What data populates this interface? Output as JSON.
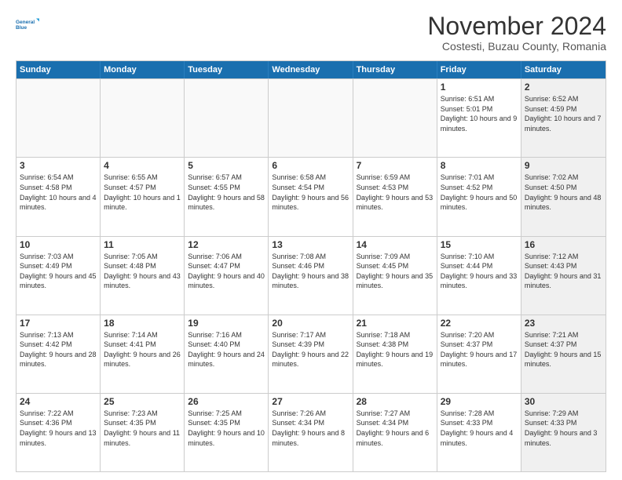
{
  "logo": {
    "line1": "General",
    "line2": "Blue"
  },
  "title": "November 2024",
  "subtitle": "Costesti, Buzau County, Romania",
  "header": {
    "days": [
      "Sunday",
      "Monday",
      "Tuesday",
      "Wednesday",
      "Thursday",
      "Friday",
      "Saturday"
    ]
  },
  "weeks": [
    {
      "cells": [
        {
          "day": "",
          "info": "",
          "empty": true
        },
        {
          "day": "",
          "info": "",
          "empty": true
        },
        {
          "day": "",
          "info": "",
          "empty": true
        },
        {
          "day": "",
          "info": "",
          "empty": true
        },
        {
          "day": "",
          "info": "",
          "empty": true
        },
        {
          "day": "1",
          "info": "Sunrise: 6:51 AM\nSunset: 5:01 PM\nDaylight: 10 hours and 9 minutes.",
          "empty": false
        },
        {
          "day": "2",
          "info": "Sunrise: 6:52 AM\nSunset: 4:59 PM\nDaylight: 10 hours and 7 minutes.",
          "empty": false,
          "shaded": true
        }
      ]
    },
    {
      "cells": [
        {
          "day": "3",
          "info": "Sunrise: 6:54 AM\nSunset: 4:58 PM\nDaylight: 10 hours and 4 minutes.",
          "empty": false
        },
        {
          "day": "4",
          "info": "Sunrise: 6:55 AM\nSunset: 4:57 PM\nDaylight: 10 hours and 1 minute.",
          "empty": false
        },
        {
          "day": "5",
          "info": "Sunrise: 6:57 AM\nSunset: 4:55 PM\nDaylight: 9 hours and 58 minutes.",
          "empty": false
        },
        {
          "day": "6",
          "info": "Sunrise: 6:58 AM\nSunset: 4:54 PM\nDaylight: 9 hours and 56 minutes.",
          "empty": false
        },
        {
          "day": "7",
          "info": "Sunrise: 6:59 AM\nSunset: 4:53 PM\nDaylight: 9 hours and 53 minutes.",
          "empty": false
        },
        {
          "day": "8",
          "info": "Sunrise: 7:01 AM\nSunset: 4:52 PM\nDaylight: 9 hours and 50 minutes.",
          "empty": false
        },
        {
          "day": "9",
          "info": "Sunrise: 7:02 AM\nSunset: 4:50 PM\nDaylight: 9 hours and 48 minutes.",
          "empty": false,
          "shaded": true
        }
      ]
    },
    {
      "cells": [
        {
          "day": "10",
          "info": "Sunrise: 7:03 AM\nSunset: 4:49 PM\nDaylight: 9 hours and 45 minutes.",
          "empty": false
        },
        {
          "day": "11",
          "info": "Sunrise: 7:05 AM\nSunset: 4:48 PM\nDaylight: 9 hours and 43 minutes.",
          "empty": false
        },
        {
          "day": "12",
          "info": "Sunrise: 7:06 AM\nSunset: 4:47 PM\nDaylight: 9 hours and 40 minutes.",
          "empty": false
        },
        {
          "day": "13",
          "info": "Sunrise: 7:08 AM\nSunset: 4:46 PM\nDaylight: 9 hours and 38 minutes.",
          "empty": false
        },
        {
          "day": "14",
          "info": "Sunrise: 7:09 AM\nSunset: 4:45 PM\nDaylight: 9 hours and 35 minutes.",
          "empty": false
        },
        {
          "day": "15",
          "info": "Sunrise: 7:10 AM\nSunset: 4:44 PM\nDaylight: 9 hours and 33 minutes.",
          "empty": false
        },
        {
          "day": "16",
          "info": "Sunrise: 7:12 AM\nSunset: 4:43 PM\nDaylight: 9 hours and 31 minutes.",
          "empty": false,
          "shaded": true
        }
      ]
    },
    {
      "cells": [
        {
          "day": "17",
          "info": "Sunrise: 7:13 AM\nSunset: 4:42 PM\nDaylight: 9 hours and 28 minutes.",
          "empty": false
        },
        {
          "day": "18",
          "info": "Sunrise: 7:14 AM\nSunset: 4:41 PM\nDaylight: 9 hours and 26 minutes.",
          "empty": false
        },
        {
          "day": "19",
          "info": "Sunrise: 7:16 AM\nSunset: 4:40 PM\nDaylight: 9 hours and 24 minutes.",
          "empty": false
        },
        {
          "day": "20",
          "info": "Sunrise: 7:17 AM\nSunset: 4:39 PM\nDaylight: 9 hours and 22 minutes.",
          "empty": false
        },
        {
          "day": "21",
          "info": "Sunrise: 7:18 AM\nSunset: 4:38 PM\nDaylight: 9 hours and 19 minutes.",
          "empty": false
        },
        {
          "day": "22",
          "info": "Sunrise: 7:20 AM\nSunset: 4:37 PM\nDaylight: 9 hours and 17 minutes.",
          "empty": false
        },
        {
          "day": "23",
          "info": "Sunrise: 7:21 AM\nSunset: 4:37 PM\nDaylight: 9 hours and 15 minutes.",
          "empty": false,
          "shaded": true
        }
      ]
    },
    {
      "cells": [
        {
          "day": "24",
          "info": "Sunrise: 7:22 AM\nSunset: 4:36 PM\nDaylight: 9 hours and 13 minutes.",
          "empty": false
        },
        {
          "day": "25",
          "info": "Sunrise: 7:23 AM\nSunset: 4:35 PM\nDaylight: 9 hours and 11 minutes.",
          "empty": false
        },
        {
          "day": "26",
          "info": "Sunrise: 7:25 AM\nSunset: 4:35 PM\nDaylight: 9 hours and 10 minutes.",
          "empty": false
        },
        {
          "day": "27",
          "info": "Sunrise: 7:26 AM\nSunset: 4:34 PM\nDaylight: 9 hours and 8 minutes.",
          "empty": false
        },
        {
          "day": "28",
          "info": "Sunrise: 7:27 AM\nSunset: 4:34 PM\nDaylight: 9 hours and 6 minutes.",
          "empty": false
        },
        {
          "day": "29",
          "info": "Sunrise: 7:28 AM\nSunset: 4:33 PM\nDaylight: 9 hours and 4 minutes.",
          "empty": false
        },
        {
          "day": "30",
          "info": "Sunrise: 7:29 AM\nSunset: 4:33 PM\nDaylight: 9 hours and 3 minutes.",
          "empty": false,
          "shaded": true
        }
      ]
    }
  ]
}
